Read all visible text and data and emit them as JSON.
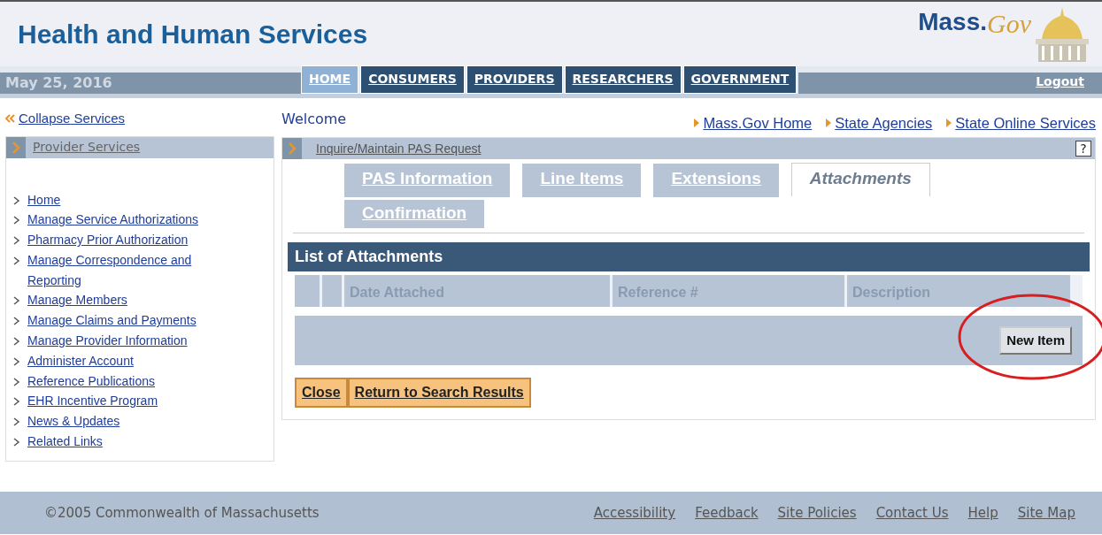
{
  "header": {
    "title": "Health and Human Services",
    "logo_main": "Mass.",
    "logo_script": "Gov"
  },
  "navbar": {
    "date": "May 25, 2016",
    "tabs": [
      {
        "label": "HOME",
        "selected": true
      },
      {
        "label": "CONSUMERS",
        "selected": false
      },
      {
        "label": "PROVIDERS",
        "selected": false
      },
      {
        "label": "RESEARCHERS",
        "selected": false
      },
      {
        "label": "GOVERNMENT",
        "selected": false
      }
    ],
    "logout": "Logout"
  },
  "sidebar": {
    "collapse": "Collapse Services",
    "section": "Provider Services",
    "items": [
      "Home",
      "Manage Service Authorizations",
      "Pharmacy Prior Authorization",
      "Manage Correspondence and Reporting",
      "Manage Members",
      "Manage Claims and Payments",
      "Manage Provider Information",
      "Administer Account",
      "Reference Publications",
      "EHR Incentive Program",
      "News & Updates",
      "Related Links"
    ]
  },
  "welcome": "Welcome",
  "top_links": [
    "Mass.Gov Home",
    "State Agencies",
    "State Online Services"
  ],
  "page": {
    "title": "Inquire/Maintain PAS Request",
    "help": "?",
    "tabs": [
      {
        "label": "PAS Information",
        "selected": false
      },
      {
        "label": "Line Items",
        "selected": false
      },
      {
        "label": "Extensions",
        "selected": false
      },
      {
        "label": "Attachments",
        "selected": true
      },
      {
        "label": "Confirmation",
        "selected": false
      }
    ],
    "panel_title": "List of Attachments",
    "columns": [
      "Date Attached",
      "Reference #",
      "Description"
    ],
    "new_item": "New Item",
    "buttons": [
      "Close",
      "Return to Search Results"
    ]
  },
  "footer": {
    "copyright": "©2005 Commonwealth of Massachusetts",
    "links": [
      "Accessibility",
      "Feedback",
      "Site Policies",
      "Contact Us",
      "Help",
      "Site Map"
    ]
  }
}
